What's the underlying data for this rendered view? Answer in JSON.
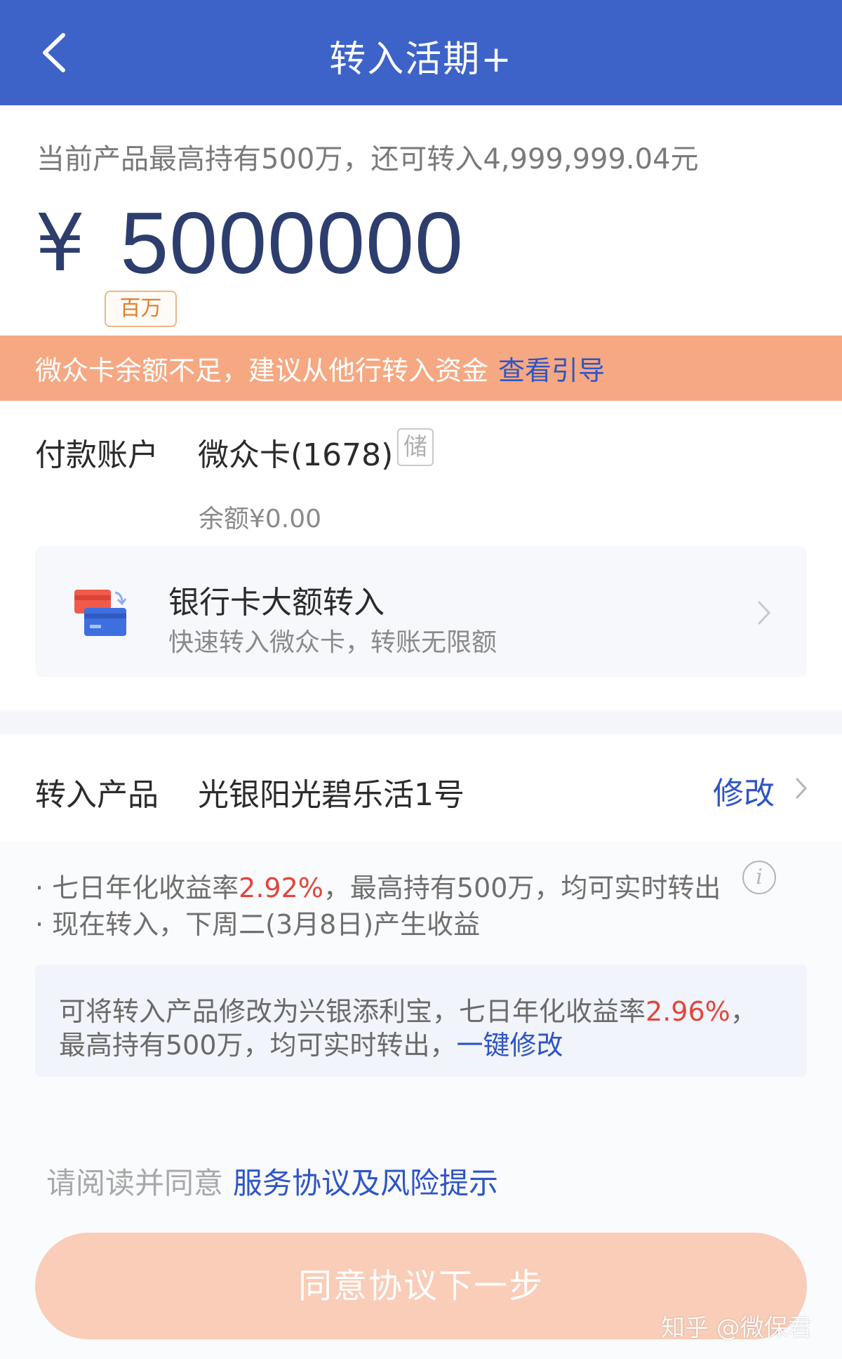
{
  "header": {
    "title": "转入活期+"
  },
  "limit_notice": "当前产品最高持有500万，还可转入4,999,999.04元",
  "amount": {
    "currency": "¥",
    "value": "5000000",
    "unit_tag": "百万"
  },
  "warning": {
    "text": "微众卡余额不足，建议从他行转入资金",
    "link": "查看引导"
  },
  "payment": {
    "label": "付款账户",
    "card": "微众卡(1678)",
    "card_type": "储",
    "balance": "余额¥0.00"
  },
  "bank_transfer": {
    "title": "银行卡大额转入",
    "subtitle": "快速转入微众卡，转账无限额"
  },
  "product": {
    "label": "转入产品",
    "name": "光银阳光碧乐活1号",
    "modify": "修改"
  },
  "info": {
    "line1_prefix": "· 七日年化收益率",
    "line1_rate": "2.92%",
    "line1_suffix": "，最高持有500万，均可实时转出",
    "info_icon": "i",
    "line2": "· 现在转入，下周二(3月8日)产生收益"
  },
  "suggestion": {
    "line1_prefix": "可将转入产品修改为兴银添利宝，七日年化收益率",
    "line1_rate": "2.96%",
    "line1_suffix": "，",
    "line2_prefix": "最高持有500万，均可实时转出，",
    "line2_link": "一键修改"
  },
  "agreement": {
    "prefix": "请阅读并同意",
    "link": "服务协议及风险提示"
  },
  "next_button": "同意协议下一步",
  "watermark": "知乎 @微保君",
  "colors": {
    "header": "#3d63c8",
    "link": "#2e55c4",
    "warning_bar": "#f6a882",
    "rate_red": "#e2453c",
    "button": "#f9cdb8"
  }
}
